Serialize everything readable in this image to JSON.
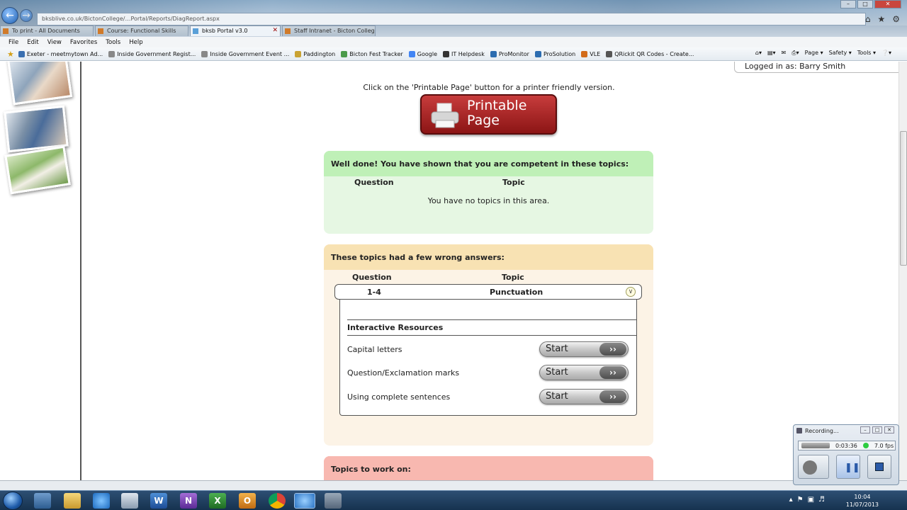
{
  "browser": {
    "url": "bksblive.co.uk/BictonCollege/…Portal/Reports/DiagReport.aspx",
    "tabs": [
      {
        "label": "To print - All Documents"
      },
      {
        "label": "Course: Functional Skills"
      },
      {
        "label": "bksb Portal v3.0"
      },
      {
        "label": "Staff Intranet - Bicton College ..."
      }
    ],
    "menu": [
      "File",
      "Edit",
      "View",
      "Favorites",
      "Tools",
      "Help"
    ],
    "favorites": [
      "Exeter - meetmytown Ad...",
      "Inside Government Regist...",
      "Inside Government Event ...",
      "Paddington",
      "Bicton Fest Tracker",
      "Google",
      "IT Helpdesk",
      "ProMonitor",
      "ProSolution",
      "VLE",
      "QRickit QR Codes - Create..."
    ],
    "commandbar": [
      "Page ▾",
      "Safety ▾",
      "Tools ▾"
    ]
  },
  "page": {
    "logged_in": "Logged in as: Barry Smith",
    "print_hint": "Click on the 'Printable Page' button for a printer friendly version.",
    "printable_line1": "Printable",
    "printable_line2": "Page",
    "competent": {
      "heading": "Well done! You have shown that you are competent in these topics:",
      "col_question": "Question",
      "col_topic": "Topic",
      "empty": "You have no topics in this area."
    },
    "wrong": {
      "heading": "These topics had a few wrong answers:",
      "col_question": "Question",
      "col_topic": "Topic",
      "row_question": "1-4",
      "row_topic": "Punctuation",
      "resources_heading": "Interactive Resources",
      "resources": [
        {
          "label": "Capital letters",
          "button": "Start"
        },
        {
          "label": "Question/Exclamation marks",
          "button": "Start"
        },
        {
          "label": "Using complete sentences",
          "button": "Start"
        }
      ]
    },
    "work_on": {
      "heading": "Topics to work on:"
    }
  },
  "recorder": {
    "title": "Recording...",
    "time": "0:03:36",
    "fps": "7.0 fps"
  },
  "taskbar": {
    "time": "10:04",
    "date": "11/07/2013"
  }
}
